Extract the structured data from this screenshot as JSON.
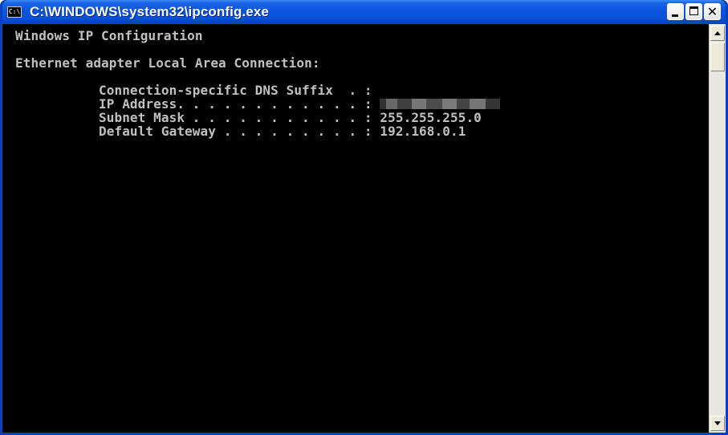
{
  "window": {
    "title": "C:\\WINDOWS\\system32\\ipconfig.exe",
    "icon": "console-icon",
    "icon_label": "C:\\",
    "controls": {
      "minimize_icon": "minimize-icon",
      "maximize_icon": "maximize-icon",
      "close_icon": "close-icon",
      "close_glyph": "✕"
    }
  },
  "console": {
    "header": "Windows IP Configuration",
    "adapter": "Ethernet adapter Local Area Connection:",
    "entries": [
      {
        "label": "Connection-specific DNS Suffix  . :",
        "value": ""
      },
      {
        "label": "IP Address. . . . . . . . . . . . :",
        "value": "",
        "redacted": true
      },
      {
        "label": "Subnet Mask . . . . . . . . . . . :",
        "value": " 255.255.255.0"
      },
      {
        "label": "Default Gateway . . . . . . . . . :",
        "value": " 192.168.0.1"
      }
    ]
  },
  "colors": {
    "title_bar": "#0a55de",
    "console_background": "#000000",
    "console_text": "#c0c0c0"
  }
}
